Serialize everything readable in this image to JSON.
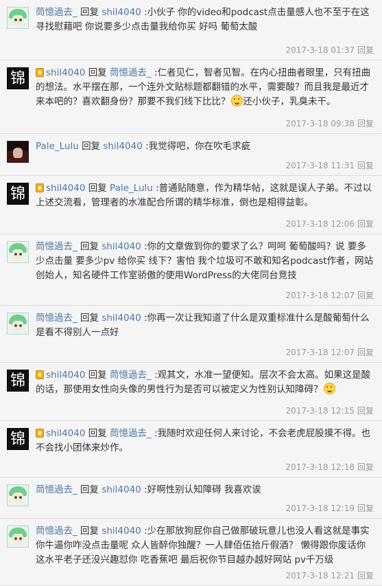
{
  "reply_word": "回复",
  "reply_action": "回复",
  "comments": [
    {
      "avatar": "anime",
      "vip": false,
      "author": "茼憶過去_",
      "to": "shil4040",
      "text": ":小伙子 你的video和podcast点击量感人也不至于在这寻找慰藉吧 你说要多少点击量我给你买 好吗 葡萄太酸",
      "time": "2017-3-18 01:37"
    },
    {
      "avatar": "jin",
      "vip": true,
      "author": "shil4040",
      "to": "茼憶過去_",
      "text": ":仁者见仁，智者见智。在内心扭曲者眼里，只有扭曲的想法。水平摆在那，一个连外文贴标题都翻错的水平，需要酸？而且我是最近才来本吧的？喜欢翻身份？那要不我们线下比比？",
      "emoji": true,
      "text2": "还小伙子，乳臭未干。",
      "time": "2017-3-18 09:38"
    },
    {
      "avatar": "lulu",
      "vip": false,
      "author": "Pale_Lulu",
      "to": "shil4040",
      "text": ":我觉得吧，你在吹毛求疵",
      "time": "2017-3-18 11:31"
    },
    {
      "avatar": "jin",
      "vip": true,
      "author": "shil4040",
      "to": "Pale_Lulu",
      "text": ":普通贴随意，作为精华帖，这就是误人子弟。不过以上述交流看，管理者的水准配合所谓的精华标准，倒也是相得益彰。",
      "time": "2017-3-18 12:06"
    },
    {
      "avatar": "anime",
      "vip": false,
      "author": "茼憶過去_",
      "to": "shil4040",
      "text": ":你的文章做到你的要求了么？呵呵 葡萄酸吗？说 要多少点击量 要多少pv 给你买 线下？害怕 我个垃圾可不敢和知名podcast作者，网站创始人，知名硬件工作室骄傲的使用WordPress的大佬同台竞技",
      "time": "2017-3-18 12:07"
    },
    {
      "avatar": "anime",
      "vip": false,
      "author": "茼憶過去_",
      "to": "shil4040",
      "text": ":你再一次让我知道了什么是双重标准什么是酸葡萄什么是看不得别人一点好",
      "time": "2017-3-18 12:07"
    },
    {
      "avatar": "jin",
      "vip": true,
      "author": "shil4040",
      "to": "茼憶過去_",
      "text": ":观其文，水准一望便知。层次不会太高。如果这是酸的话，那使用女性向头像的男性行为是否可以被定义为性别认知障碍？",
      "emoji": true,
      "text2": "",
      "time": "2017-3-18 12:15"
    },
    {
      "avatar": "jin",
      "vip": true,
      "author": "shil4040",
      "to": "茼憶過去_",
      "text": ":我随时欢迎任何人来讨论，不会老虎屁股摸不得。也不会找小团体来炒作。",
      "time": "2017-3-18 12:18"
    },
    {
      "avatar": "anime",
      "vip": false,
      "author": "茼憶過去_",
      "to": "shil4040",
      "text": ":好啊性别认知障碍 我喜欢诶",
      "time": "2017-3-18 12:19"
    },
    {
      "avatar": "anime",
      "vip": false,
      "author": "茼憶過去_",
      "to": "shil4040",
      "text": ":少在那放狗屁你自己做那破玩意儿也没人看这就是事实你牛逼你咋没点击量呢 众人皆醉你独醒？一人肆佰伍拾斤假酒？ 懒得跟你废话你这水平老子还没兴趣怼你 吃香蕉吧 最后祝你节目越办越好网站 pv千万级",
      "time": "2017-3-18 12:21"
    }
  ]
}
